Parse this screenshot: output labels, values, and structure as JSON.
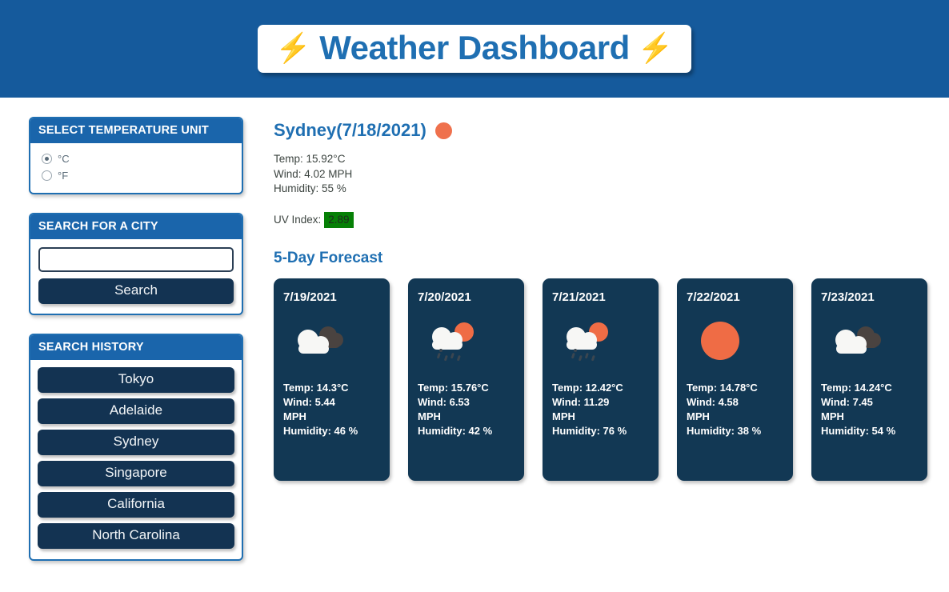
{
  "header": {
    "title": "Weather Dashboard",
    "bolt_left": "⚡",
    "bolt_right": "⚡",
    "banner_color": "#155a9c",
    "title_color": "#1f6fb2"
  },
  "sidebar": {
    "unit_panel": {
      "heading": "SELECT TEMPERATURE UNIT",
      "options": [
        {
          "label": "°C",
          "selected": true
        },
        {
          "label": "°F",
          "selected": false
        }
      ]
    },
    "search_panel": {
      "heading": "SEARCH FOR A CITY",
      "input_value": "",
      "input_placeholder": "",
      "button_label": "Search"
    },
    "history_panel": {
      "heading": "SEARCH HISTORY",
      "items": [
        "Tokyo",
        "Adelaide",
        "Sydney",
        "Singapore",
        "California",
        "North Carolina"
      ]
    }
  },
  "current": {
    "title": "Sydney(7/18/2021)",
    "icon": "sun-icon",
    "temp": "Temp: 15.92°C",
    "wind": "Wind: 4.02 MPH",
    "humidity": "Humidity: 55 %",
    "uv_label": "UV Index:",
    "uv_value": "2.89",
    "uv_badge_color": "#068006"
  },
  "forecast": {
    "heading": "5-Day Forecast",
    "days": [
      {
        "date": "7/19/2021",
        "icon": "broken-clouds-icon",
        "temp": "Temp: 14.3°C",
        "wind": "Wind: 5.44",
        "wind_unit": "MPH",
        "humidity": "Humidity: 46 %"
      },
      {
        "date": "7/20/2021",
        "icon": "sun-rain-cloud-icon",
        "temp": "Temp: 15.76°C",
        "wind": "Wind: 6.53",
        "wind_unit": "MPH",
        "humidity": "Humidity: 42 %"
      },
      {
        "date": "7/21/2021",
        "icon": "sun-rain-cloud-icon",
        "temp": "Temp: 12.42°C",
        "wind": "Wind: 11.29",
        "wind_unit": "MPH",
        "humidity": "Humidity: 76 %"
      },
      {
        "date": "7/22/2021",
        "icon": "sun-icon",
        "temp": "Temp: 14.78°C",
        "wind": "Wind: 4.58",
        "wind_unit": "MPH",
        "humidity": "Humidity: 38 %"
      },
      {
        "date": "7/23/2021",
        "icon": "broken-clouds-icon",
        "temp": "Temp: 14.24°C",
        "wind": "Wind: 7.45",
        "wind_unit": "MPH",
        "humidity": "Humidity: 54 %"
      }
    ]
  }
}
